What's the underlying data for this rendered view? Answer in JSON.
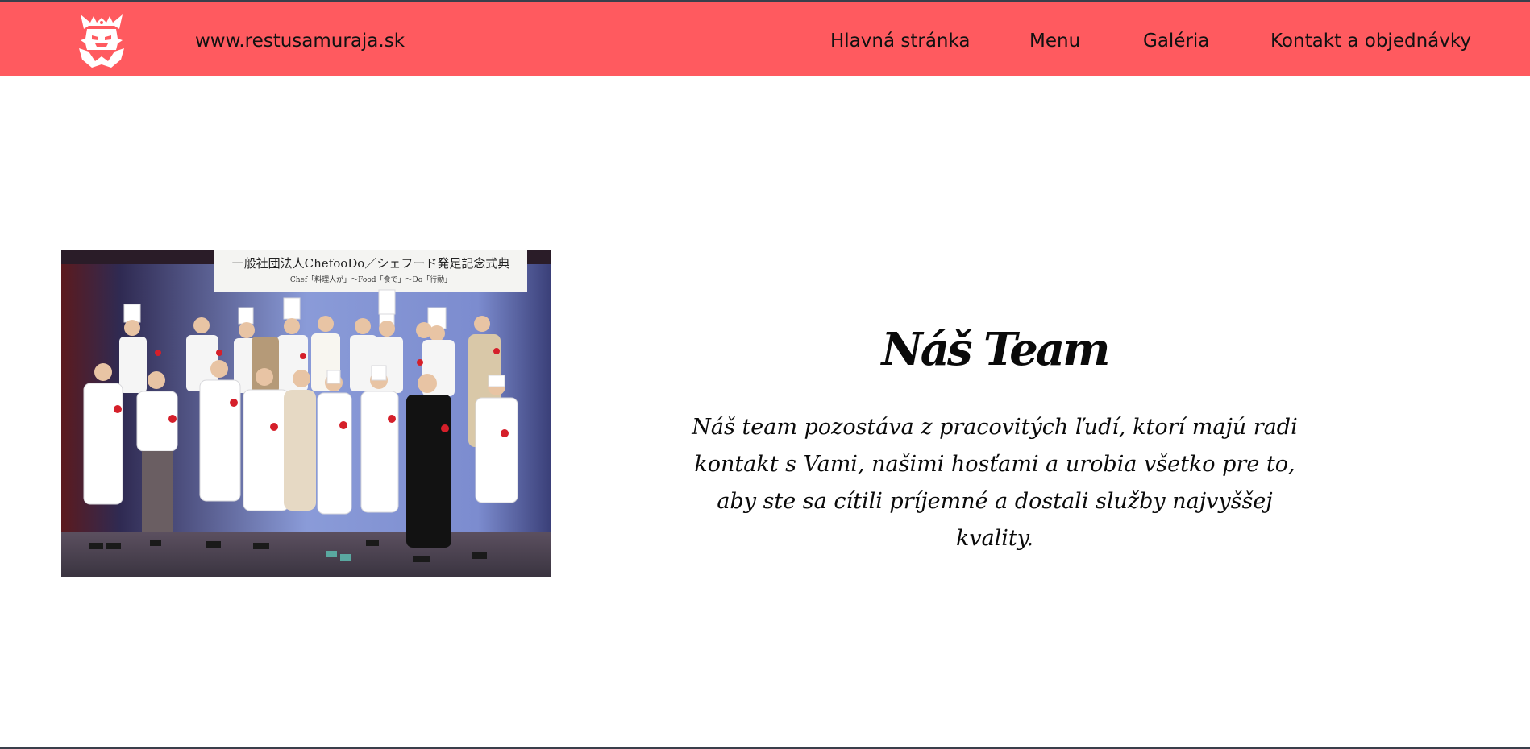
{
  "header": {
    "site_url": "www.restusamuraja.sk",
    "logo_icon": "samurai-helmet-icon",
    "nav": [
      {
        "label": "Hlavná stránka"
      },
      {
        "label": "Menu"
      },
      {
        "label": "Galéria"
      },
      {
        "label": "Kontakt a objednávky"
      }
    ]
  },
  "team": {
    "title": "Náš Team",
    "text": "Náš team pozostáva z pracovitých ľudí, ktorí majú radi kontakt s Vami, našimi hosťami a urobia všetko pre to, aby ste sa cítili príjemné a dostali služby najvyššej kvality.",
    "photo": {
      "banner_line1": "一般社団法人ChefooDo／シェフード発足記念式典",
      "banner_line2": "Chef「料理人が」〜Food「食で」〜Do「行動」"
    }
  },
  "colors": {
    "navbar": "#ff5a5f",
    "text": "#111111",
    "background": "#ffffff",
    "edge": "#3a3f4b"
  }
}
